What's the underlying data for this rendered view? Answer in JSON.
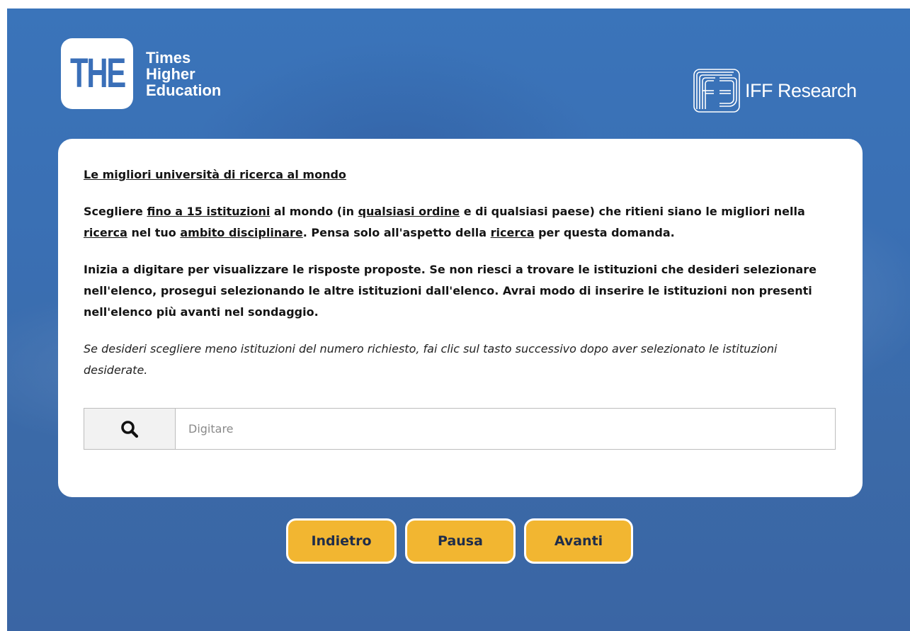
{
  "header": {
    "the_logo": {
      "mark": "THE",
      "line1": "Times",
      "line2": "Higher",
      "line3": "Education"
    },
    "iff_logo": {
      "text": "IFF Research",
      "icon": "iff-mark-icon"
    }
  },
  "question": {
    "title": "Le migliori università di ricerca al mondo",
    "p1_a": "Scegliere ",
    "p1_u1": "fino a 15 istituzioni",
    "p1_b": " al mondo (in ",
    "p1_u2": "qualsiasi ordine",
    "p1_c": " e di qualsiasi paese) che ritieni siano le migliori nella ",
    "p1_u3": "ricerca",
    "p1_d": " nel tuo ",
    "p1_u4": "ambito disciplinare",
    "p1_e": ". Pensa solo all'aspetto della ",
    "p1_u5": "ricerca",
    "p1_f": " per questa domanda.",
    "p2": "Inizia a digitare per visualizzare le risposte proposte. Se non riesci a trovare le istituzioni che desideri selezionare nell'elenco, prosegui selezionando le altre istituzioni dall'elenco. Avrai modo di inserire le istituzioni non presenti nell'elenco più avanti nel sondaggio.",
    "note": "Se desideri scegliere meno istituzioni del numero richiesto, fai clic sul tasto successivo dopo aver selezionato le istituzioni desiderate."
  },
  "search": {
    "icon": "search-icon",
    "placeholder": "Digitare",
    "value": ""
  },
  "nav": {
    "back_label": "Indietro",
    "pause_label": "Pausa",
    "next_label": "Avanti"
  },
  "colors": {
    "background": "#3a6fb3",
    "button": "#f2b631",
    "button_text": "#1f2d4a",
    "card": "#ffffff"
  }
}
